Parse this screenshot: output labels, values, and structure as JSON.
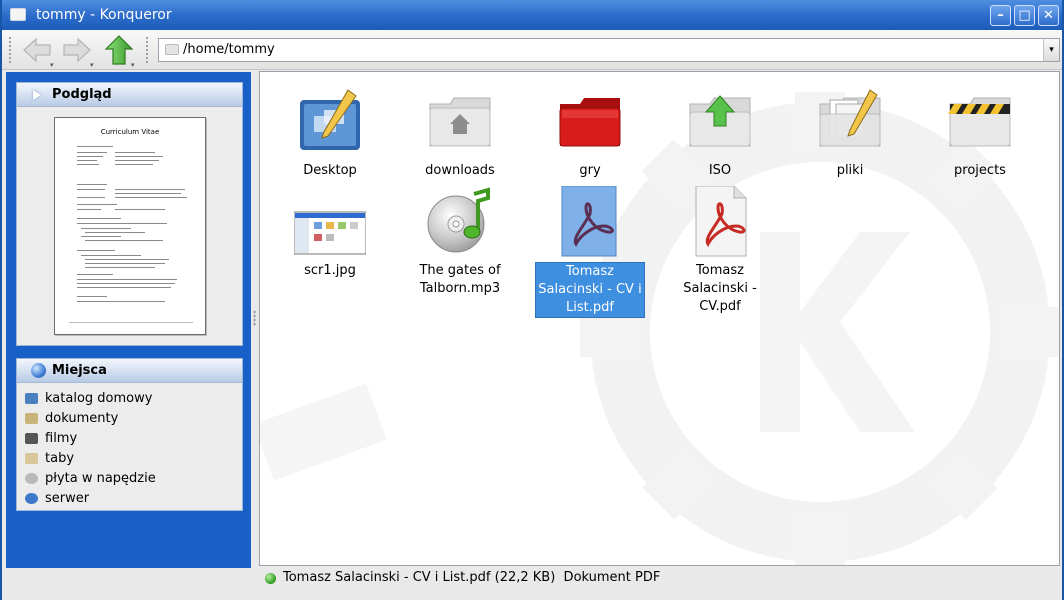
{
  "window": {
    "title": "tommy - Konqueror"
  },
  "toolbar": {
    "location_path": "/home/tommy"
  },
  "sidebar": {
    "preview": {
      "heading": "Podgląd",
      "document_title": "Curriculum Vitae"
    },
    "places": {
      "heading": "Miejsca",
      "items": [
        {
          "label": "katalog domowy",
          "icon": "home-folder-icon",
          "color": "#4a7fc0"
        },
        {
          "label": "dokumenty",
          "icon": "documents-icon",
          "color": "#c8b37a"
        },
        {
          "label": "filmy",
          "icon": "film-icon",
          "color": "#555555"
        },
        {
          "label": "taby",
          "icon": "tabs-folder-icon",
          "color": "#d7c79a"
        },
        {
          "label": "płyta w napędzie",
          "icon": "cdrom-icon",
          "color": "#b9b9b9"
        },
        {
          "label": "serwer",
          "icon": "server-icon",
          "color": "#3d78c9"
        }
      ]
    }
  },
  "files": [
    {
      "name": "Desktop",
      "type": "desktop-folder-icon"
    },
    {
      "name": "downloads",
      "type": "home-folder-icon"
    },
    {
      "name": "gry",
      "type": "red-folder-icon"
    },
    {
      "name": "ISO",
      "type": "upload-folder-icon"
    },
    {
      "name": "pliki",
      "type": "documents-folder-icon"
    },
    {
      "name": "projects",
      "type": "construction-folder-icon"
    },
    {
      "name": "scr1.jpg",
      "type": "image-thumbnail-icon"
    },
    {
      "name": "The gates of Talborn.mp3",
      "type": "audio-cd-icon"
    },
    {
      "name": "Tomasz Salacinski - CV i List.pdf",
      "type": "pdf-icon",
      "selected": true
    },
    {
      "name": "Tomasz Salacinski - CV.pdf",
      "type": "pdf-icon"
    }
  ],
  "status": {
    "text": "Tomasz Salacinski - CV i List.pdf (22,2 KB)  Dokument PDF"
  },
  "colors": {
    "accent": "#1860c8",
    "selection": "#3e8fe0",
    "titlebar": "#2a6ac9"
  }
}
